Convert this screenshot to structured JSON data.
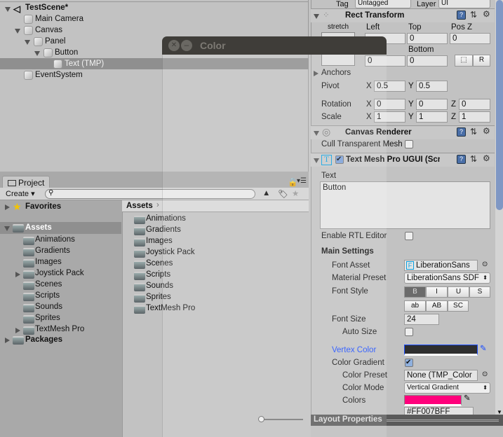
{
  "hierarchy": {
    "scene": "TestScene*",
    "items": [
      "Main Camera",
      "Canvas",
      "Panel",
      "Button",
      "Text (TMP)",
      "EventSystem"
    ]
  },
  "project": {
    "tab": "Project",
    "create": "Create",
    "search_placeholder": "",
    "favorites": "Favorites",
    "assets": "Assets",
    "packages": "Packages",
    "tree": [
      "Animations",
      "Gradients",
      "Images",
      "Joystick Pack",
      "Scenes",
      "Scripts",
      "Sounds",
      "Sprites",
      "TextMesh Pro"
    ],
    "breadcrumb": "Assets",
    "grid": [
      "Animations",
      "Gradients",
      "Images",
      "Joystick Pack",
      "Scenes",
      "Scripts",
      "Sounds",
      "Sprites",
      "TextMesh Pro"
    ]
  },
  "color_window": {
    "title": "Color"
  },
  "inspector": {
    "tag_label": "Tag",
    "tag_value": "Untagged",
    "layer_label": "Layer",
    "layer_value": "UI",
    "rect": {
      "title": "Rect Transform",
      "stretch": "stretch",
      "left": "Left",
      "top": "Top",
      "posz": "Pos Z",
      "bottom": "Bottom",
      "top_v": "0",
      "posz_v": "0",
      "right_v": "0",
      "bottom_v": "0",
      "r_btn": "R",
      "anchors": "Anchors",
      "pivot": "Pivot",
      "pivot_x": "0.5",
      "pivot_y": "0.5",
      "rotation": "Rotation",
      "rot_x": "0",
      "rot_y": "0",
      "rot_z": "0",
      "scale": "Scale",
      "scale_x": "1",
      "scale_y": "1",
      "scale_z": "1",
      "x": "X",
      "y": "Y",
      "z": "Z"
    },
    "canvas_renderer": {
      "title": "Canvas Renderer",
      "cull": "Cull Transparent Mesh"
    },
    "tmp": {
      "title": "Text Mesh Pro UGUI (Script)",
      "text_label": "Text",
      "text_value": "Button",
      "rtl": "Enable RTL Editor",
      "main_settings": "Main Settings",
      "font_asset": "Font Asset",
      "font_asset_v": "LiberationSans SDF",
      "material_preset": "Material Preset",
      "material_preset_v": "LiberationSans SDF",
      "font_style": "Font Style",
      "styles": [
        "B",
        "I",
        "U",
        "S"
      ],
      "styles2": [
        "ab",
        "AB",
        "SC"
      ],
      "font_size": "Font Size",
      "font_size_v": "24",
      "auto_size": "Auto Size",
      "vertex_color": "Vertex Color",
      "color_gradient": "Color Gradient",
      "color_preset": "Color Preset",
      "color_preset_v": "None (TMP_Color Gradient)",
      "color_mode": "Color Mode",
      "color_mode_v": "Vertical Gradient",
      "colors": "Colors",
      "colors_hex": "#FF007BFF"
    },
    "layout_properties": "Layout Properties"
  },
  "colors": {
    "vertex": "#2e2e2e",
    "gradient": "#ff007b",
    "accent": "#1a4cff"
  }
}
